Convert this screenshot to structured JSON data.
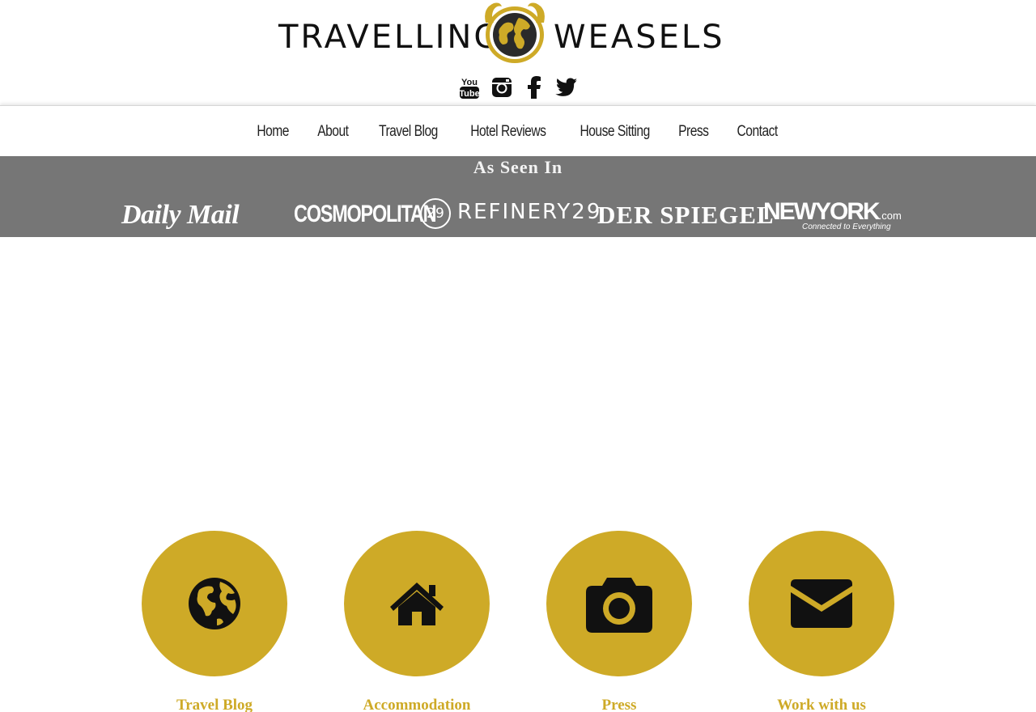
{
  "header": {
    "logo_left": "TRAVELLING",
    "logo_right": "WEASELS",
    "accent_color": "#ceaa27"
  },
  "social": [
    {
      "name": "youtube-icon",
      "label": "You Tube"
    },
    {
      "name": "instagram-icon"
    },
    {
      "name": "facebook-icon"
    },
    {
      "name": "twitter-icon"
    }
  ],
  "nav": {
    "items": [
      "Home",
      "About",
      "Travel Blog",
      "Hotel Reviews",
      "House Sitting",
      "Press",
      "Contact"
    ]
  },
  "as_seen_in": {
    "title": "As Seen In",
    "band_color": "#767676",
    "logos": {
      "daily_mail": "Daily Mail",
      "cosmopolitan": "COSMOPOLITAN",
      "refinery_mark": "29",
      "refinery": "REFINERY29",
      "spiegel": "DER SPIEGEL",
      "newyork": "NEWYORK",
      "newyork_suffix": ".com",
      "newyork_tagline": "Connected to Everything"
    }
  },
  "features": [
    {
      "label": "Travel Blog",
      "icon": "globe-icon"
    },
    {
      "label": "Accommodation",
      "icon": "home-icon"
    },
    {
      "label": "Press",
      "icon": "camera-icon"
    },
    {
      "label": "Work with us",
      "icon": "envelope-icon"
    }
  ]
}
